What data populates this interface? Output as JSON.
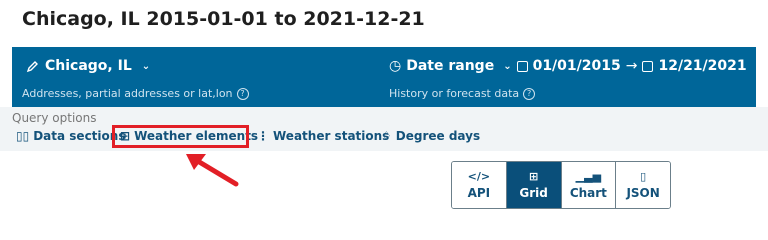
{
  "page": {
    "title": "Chicago, IL 2015-01-01 to 2021-12-21"
  },
  "location": {
    "value": "Chicago, IL",
    "hint": "Addresses, partial addresses or lat,lon"
  },
  "date_range": {
    "label": "Date range",
    "start": "01/01/2015",
    "end": "12/21/2021",
    "hint": "History or forecast data"
  },
  "query_options": {
    "label": "Query options",
    "items": [
      {
        "label": "Data sections",
        "icon": "layout-icon"
      },
      {
        "label": "Weather elements",
        "icon": "grid-icon",
        "highlighted": true
      },
      {
        "label": "Weather stations",
        "icon": "dots-vertical-icon"
      },
      {
        "label": "Degree days",
        "icon": "bell-icon"
      }
    ]
  },
  "views": [
    {
      "label": "API",
      "icon": "</>"
    },
    {
      "label": "Grid",
      "icon": "⊞",
      "active": true
    },
    {
      "label": "Chart",
      "icon": "▁▃▅"
    },
    {
      "label": "JSON",
      "icon": "▯"
    }
  ],
  "colors": {
    "bar": "#006699",
    "highlight": "#e21f26",
    "active_view": "#0a4f7a"
  }
}
